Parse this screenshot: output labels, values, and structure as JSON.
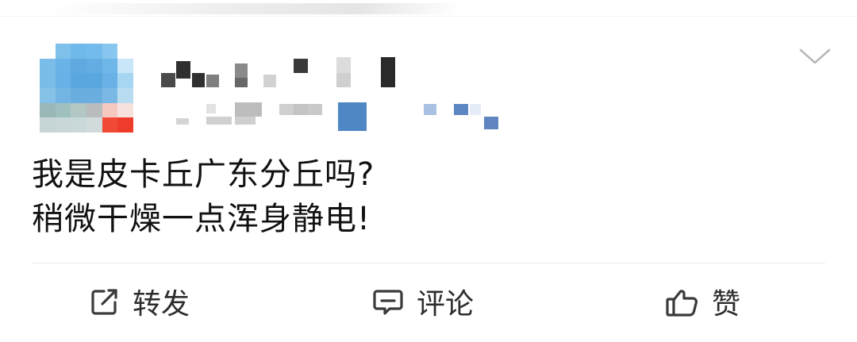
{
  "post": {
    "lines": [
      "我是皮卡丘广东分丘吗?",
      "稍微干燥一点浑身静电!"
    ]
  },
  "header": {
    "avatar": {
      "kind": "pixelated-avatar"
    },
    "menu_icon": "chevron-down-icon"
  },
  "actions": {
    "repost": {
      "label": "转发",
      "icon": "share-icon"
    },
    "comment": {
      "label": "评论",
      "icon": "comment-icon"
    },
    "like": {
      "label": "赞",
      "icon": "thumbs-up-icon"
    }
  },
  "colors": {
    "text": "#111111",
    "action_text": "#2d2d2d",
    "divider": "#ebebeb",
    "chevron": "#b8b8b8"
  }
}
